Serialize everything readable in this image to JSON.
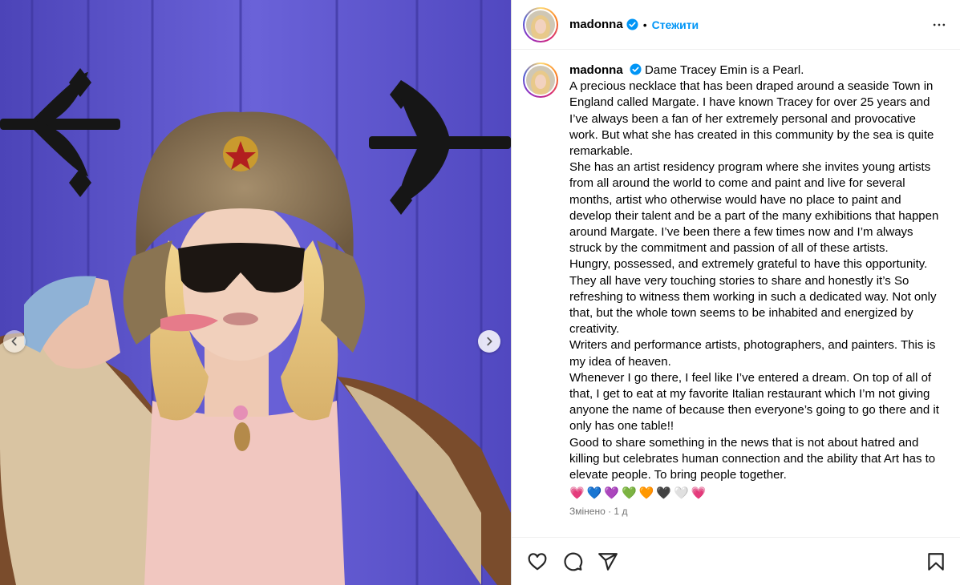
{
  "post": {
    "username": "madonna",
    "dot": "•",
    "follow_label": "Стежити",
    "caption_intro": "Dame Tracey Emin is a Pearl.",
    "caption_paragraphs": [
      "A precious necklace that has been draped around a seaside Town in England called Margate. I have known Tracey for over 25 years and I’ve always been a fan of her extremely personal and provocative work. But what she has created in this community by the sea is quite remarkable.",
      "She has an artist residency program where she invites young artists from all around the world to come and paint and live for several months, artist who otherwise would have no place to paint and develop their talent  and be a part of the many exhibitions that happen  around  Margate. I’ve been there a few times now and I’m always struck by the commitment and passion of all of these artists.",
      "Hungry, possessed, and extremely grateful to have this opportunity. They all have very touching stories to share and honestly  it’s So refreshing to witness them working in such a dedicated way. Not only that, but the whole town seems to be inhabited  and energized by creativity.",
      "Writers and performance artists, photographers, and painters. This is my idea of heaven.",
      "Whenever I go there, I feel like I’ve entered a dream. On top of all of that, I get to eat at my favorite Italian restaurant which I’m not giving anyone the name of because then everyone’s going to go there and it only has one table!!",
      "Good to share something in the news that is not about hatred and killing but celebrates human connection and the ability that Art has to elevate people. To bring people together."
    ],
    "hearts": "💗💙💜💚🧡🖤🤍💗",
    "edited": "Змінено · 1 д"
  },
  "icons": {
    "verified": "verified-badge-icon",
    "more": "more-options-icon",
    "like": "heart-icon",
    "comment": "comment-icon",
    "share": "share-icon",
    "save": "bookmark-icon",
    "prev": "chevron-left-icon",
    "next": "chevron-right-icon"
  },
  "colors": {
    "accent": "#0095f6",
    "verified": "#0095f6",
    "door": "#5b54c8"
  }
}
